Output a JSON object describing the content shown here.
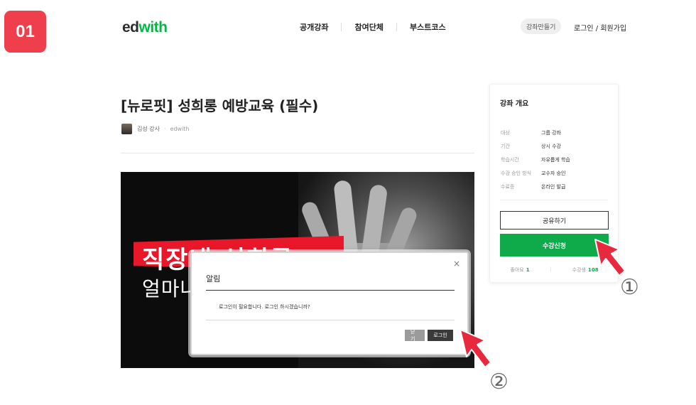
{
  "step_badge": "01",
  "logo": {
    "part1": "ed",
    "part2": "with"
  },
  "nav": {
    "items": [
      "공개강좌",
      "참여단체",
      "부스트코스"
    ]
  },
  "header": {
    "create_course": "강좌만들기",
    "login_join": "로그인 / 회원가입"
  },
  "course": {
    "title": "[뉴로핏] 성희롱 예방교육 (필수)",
    "instructor": "김성 강사",
    "provider": "edwith",
    "banner_line1": "직장내 성희롱",
    "banner_line2": "얼마나 알고계세요"
  },
  "modal": {
    "close_glyph": "×",
    "title": "알림",
    "message": "로그인이 필요합니다. 로그인 하시겠습니까?",
    "close_label": "닫기",
    "login_label": "로그인"
  },
  "sidebar": {
    "title": "강좌 개요",
    "info": [
      {
        "key": "대상",
        "value": "그룹 강좌"
      },
      {
        "key": "기간",
        "value": "상시 수강"
      },
      {
        "key": "학습시간",
        "value": "자유롭게 학습"
      },
      {
        "key": "수강 승인 방식",
        "value": "교수자 승인"
      },
      {
        "key": "수료증",
        "value": "온라인 발급"
      }
    ],
    "share_label": "공유하기",
    "enroll_label": "수강신청",
    "likes_label": "좋아요",
    "likes_count": "1",
    "students_label": "수강생",
    "students_count": "108"
  },
  "annotations": {
    "marker1": "①",
    "marker2": "②"
  },
  "colors": {
    "accent_green": "#0faa4a",
    "badge_red": "#ef3f4c",
    "arrow_red": "#e8283c"
  }
}
